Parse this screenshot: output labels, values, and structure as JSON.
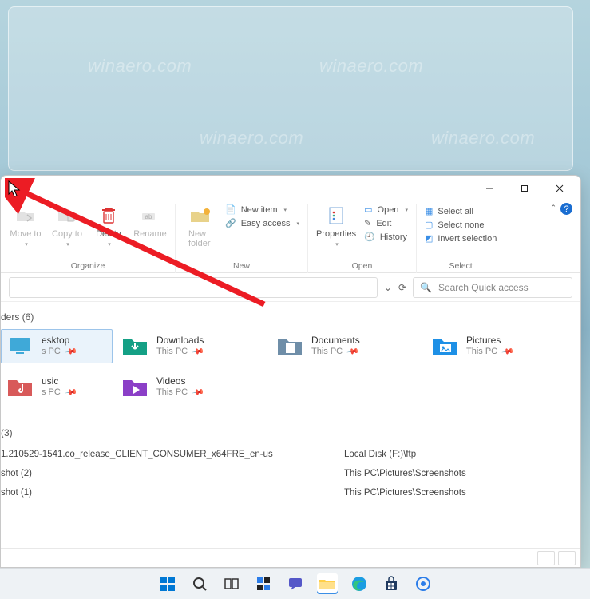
{
  "window_controls": {
    "min": "Minimize",
    "max": "Maximize",
    "close": "Close"
  },
  "ribbon": {
    "organize": {
      "move_to": "Move to",
      "copy_to": "Copy to",
      "delete": "Delete",
      "rename": "Rename",
      "label": "Organize"
    },
    "new": {
      "new_folder": "New folder",
      "new_item": "New item",
      "easy_access": "Easy access",
      "label": "New"
    },
    "open": {
      "properties": "Properties",
      "open": "Open",
      "edit": "Edit",
      "history": "History",
      "label": "Open"
    },
    "select": {
      "select_all": "Select all",
      "select_none": "Select none",
      "invert": "Invert selection",
      "label": "Select"
    },
    "help_tooltip": "Help"
  },
  "navrow": {
    "refresh": "Refresh",
    "search_placeholder": "Search Quick access"
  },
  "sections": {
    "folders_header": "ders (6)",
    "recent_header": "(3)",
    "folders": [
      {
        "name": "esktop",
        "sub": "s PC",
        "icon": "desktop",
        "selected": true
      },
      {
        "name": "Downloads",
        "sub": "This PC",
        "icon": "downloads"
      },
      {
        "name": "Documents",
        "sub": "This PC",
        "icon": "documents"
      },
      {
        "name": "Pictures",
        "sub": "This PC",
        "icon": "pictures"
      },
      {
        "name": "usic",
        "sub": "s PC",
        "icon": "music"
      },
      {
        "name": "Videos",
        "sub": "This PC",
        "icon": "videos"
      }
    ],
    "recent": [
      {
        "name": "1.210529-1541.co_release_CLIENT_CONSUMER_x64FRE_en-us",
        "loc": "Local Disk (F:)\\ftp"
      },
      {
        "name": "shot (2)",
        "loc": "This PC\\Pictures\\Screenshots"
      },
      {
        "name": "shot (1)",
        "loc": "This PC\\Pictures\\Screenshots"
      }
    ]
  },
  "taskbar": {
    "items": [
      "start",
      "search",
      "task-view",
      "widgets",
      "chat",
      "explorer",
      "edge",
      "store",
      "settings"
    ]
  },
  "watermark": "winaero.com"
}
